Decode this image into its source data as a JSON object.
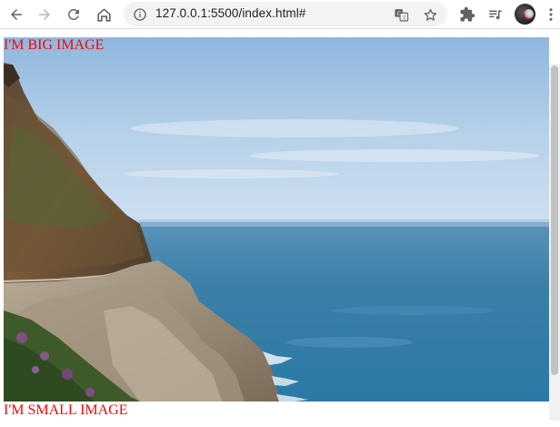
{
  "browser": {
    "url": "127.0.0.1:5500/index.html#",
    "icons": {
      "back": "back-arrow-icon",
      "forward": "forward-arrow-icon",
      "reload": "reload-icon",
      "home": "home-icon",
      "site_info": "info-icon",
      "translate": "translate-icon",
      "bookmark": "star-icon",
      "extensions": "puzzle-icon",
      "media": "media-queue-icon",
      "profile": "avatar"
    }
  },
  "page": {
    "big_label": "I'M BIG IMAGE",
    "small_label": "I'M SMALL IMAGE",
    "label_color": "#ff0000",
    "image": "coastal cliff and ocean photo"
  }
}
